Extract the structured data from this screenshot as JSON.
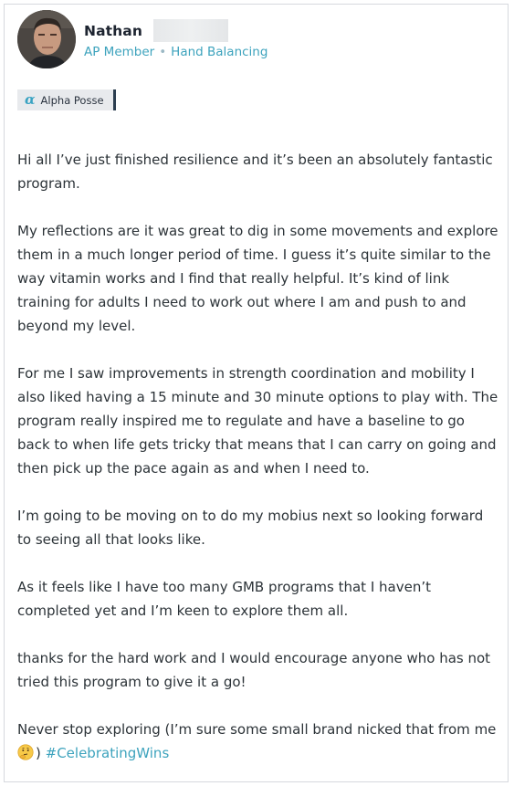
{
  "post": {
    "author": {
      "name": "Nathan",
      "role": "AP Member",
      "group": "Hand Balancing"
    },
    "badge": {
      "icon": "alpha-icon",
      "glyph": "α",
      "label": "Alpha Posse"
    },
    "paragraphs": [
      "Hi all I’ve just finished resilience and it’s been an absolutely fantastic program.",
      "My reflections are it was great to dig in some movements and explore them in a much longer period of time. I guess it’s quite similar to the way vitamin works and I find that really helpful. It’s kind of link training for adults I need to work out where I am and push to and beyond my level.",
      "For me I saw improvements in strength coordination and mobility I also liked having a 15 minute and 30 minute options to play with. The program really inspired me to regulate and have a baseline to go back to when life gets tricky that means that I can carry on going and then pick up the pace again as and when I need to.",
      "I’m going to be moving on to do my mobius next so looking forward to seeing all that looks like.",
      "As it feels like I have too many GMB programs that I haven’t completed yet and I’m keen to explore them all.",
      "thanks for the hard work and I would encourage anyone who has not tried this program to give it a go!"
    ],
    "closing": {
      "text_start": "Never stop exploring (I’m sure some small brand nicked that from me",
      "emoji": "thinking-face-icon",
      "text_end": ")",
      "hashtag": "#CelebratingWins"
    }
  },
  "colors": {
    "accent": "#3da3bd",
    "text": "#2c3338",
    "name": "#1d2430",
    "badge_bg": "#e8eaed",
    "badge_bar": "#2c3e50"
  }
}
